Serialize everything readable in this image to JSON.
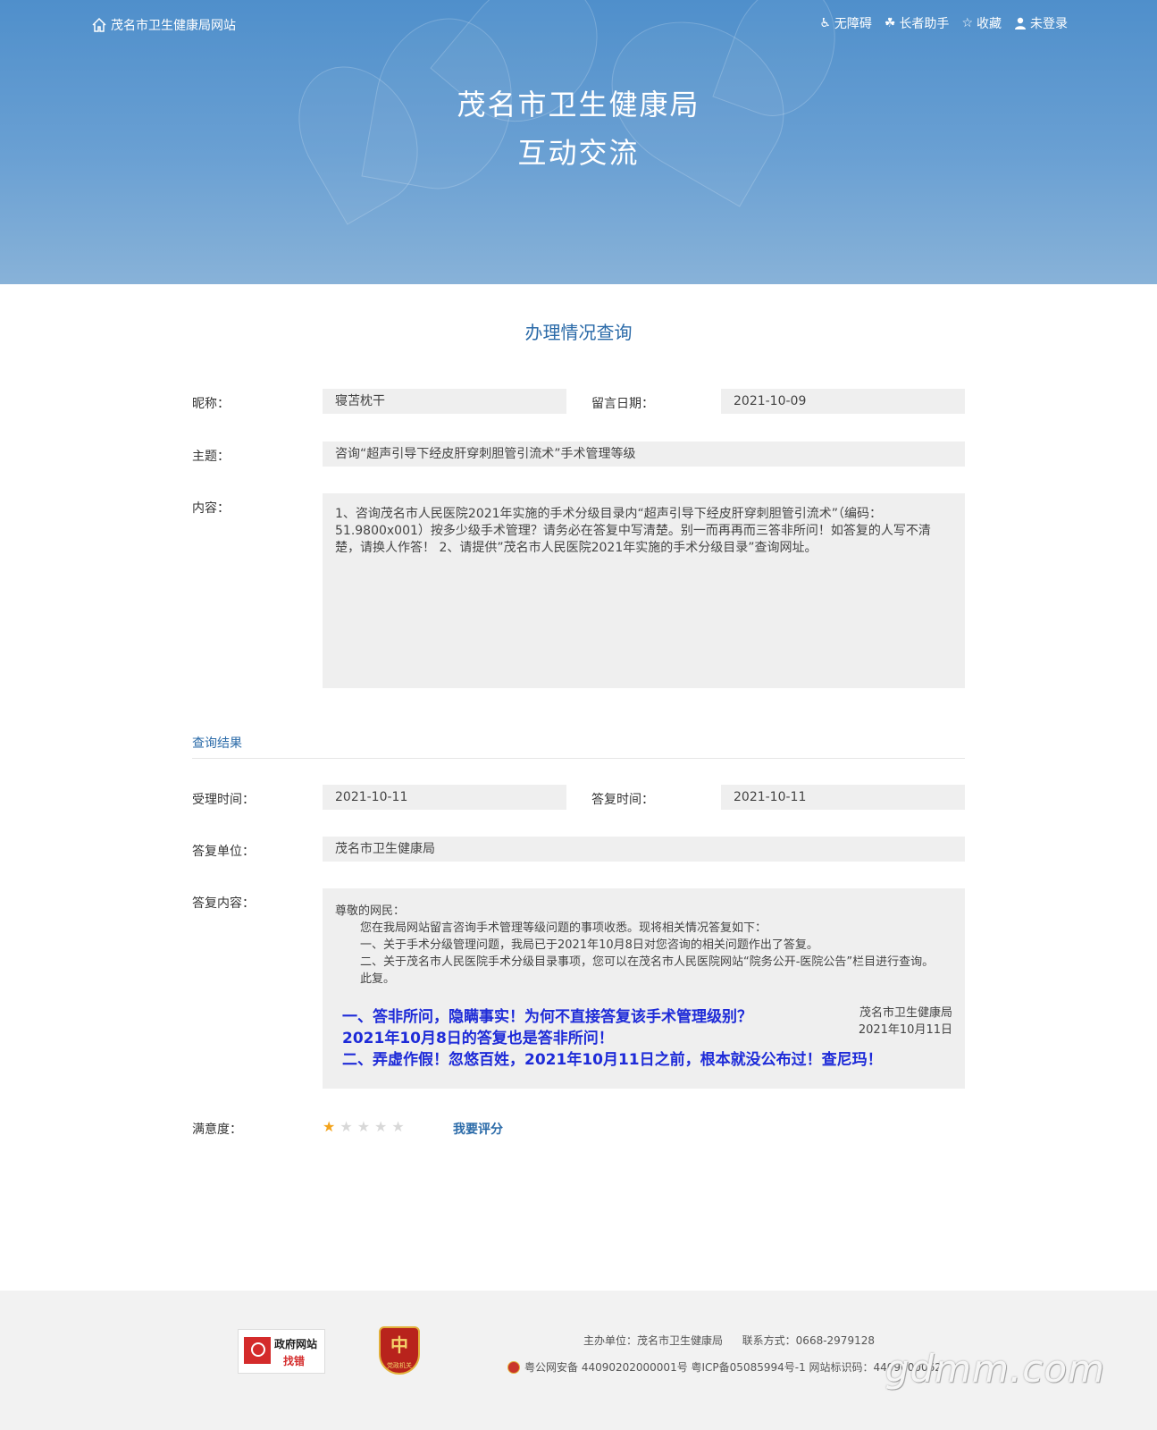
{
  "header": {
    "site_link": "茂名市卫生健康局网站",
    "links": [
      {
        "icon": "wheelchair-icon",
        "label": "无障碍"
      },
      {
        "icon": "elder-helper-icon",
        "label": "长者助手"
      },
      {
        "icon": "star-outline-icon",
        "label": "收藏"
      },
      {
        "icon": "user-icon",
        "label": "未登录"
      }
    ],
    "title_line1": "茂名市卫生健康局",
    "title_line2": "互动交流"
  },
  "main": {
    "heading": "办理情况查询",
    "nickname_label": "昵称：",
    "nickname": "寝苫枕干",
    "date_label": "留言日期：",
    "date": "2021-10-09",
    "subject_label": "主题：",
    "subject": "咨询“超声引导下经皮肝穿刺胆管引流术”手术管理等级",
    "content_label": "内容：",
    "content": "1、咨询茂名市人民医院2021年实施的手术分级目录内“超声引导下经皮肝穿刺胆管引流术”（编码：51.9800x001）按多少级手术管理？请务必在答复中写清楚。别一而再再而三答非所问！如答复的人写不清楚，请换人作答！ 2、请提供”茂名市人民医院2021年实施的手术分级目录”查询网址。"
  },
  "result": {
    "section_title": "查询结果",
    "accept_time_label": "受理时间：",
    "accept_time": "2021-10-11",
    "reply_time_label": "答复时间：",
    "reply_time": "2021-10-11",
    "reply_unit_label": "答复单位：",
    "reply_unit": "茂名市卫生健康局",
    "reply_content_label": "答复内容：",
    "reply_lines": [
      "尊敬的网民：",
      "您在我局网站留言咨询手术管理等级问题的事项收悉。现将相关情况答复如下：",
      "一、关于手术分级管理问题，我局已于2021年10月8日对您咨询的相关问题作出了答复。",
      "二、关于茂名市人民医院手术分级目录事项，您可以在茂名市人民医院网站“院务公开-医院公告”栏目进行查询。",
      "此复。"
    ],
    "signature": "茂名市卫生健康局",
    "signature_date": "2021年10月11日",
    "blue_note": [
      "一、答非所问，隐瞒事实！为何不直接答复该手术管理级别？",
      "2021年10月8日的答复也是答非所问！",
      "二、弄虚作假！忽悠百姓，2021年10月11日之前，根本就没公布过！查尼玛！"
    ],
    "satisfaction_label": "满意度：",
    "rating": 1,
    "rating_max": 5,
    "rate_link": "我要评分"
  },
  "footer": {
    "badge1_line1": "政府网站",
    "badge1_line2": "找错",
    "badge2_char": "中",
    "badge2_small": "党政机关",
    "sponsor": "主办单位：茂名市卫生健康局",
    "contact": "联系方式：0668-2979128",
    "record": "粤公网安备 44090202000001号 粤ICP备05085994号-1 网站标识码：4409000062",
    "watermark": "gdmm.com"
  }
}
